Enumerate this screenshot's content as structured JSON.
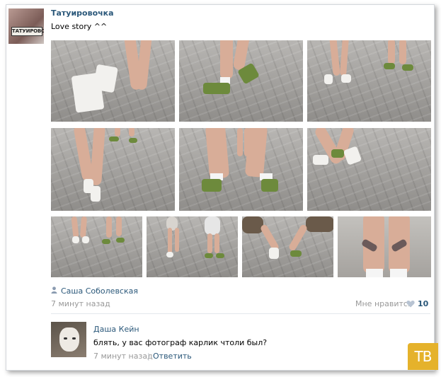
{
  "post": {
    "author": "Татуировочка",
    "avatar_text": "ТАТУИРОВОЧКА",
    "text": "Love story ^^",
    "photos": [
      {
        "scene": "heels-walking"
      },
      {
        "scene": "sneakers-walking"
      },
      {
        "scene": "couple-walking"
      },
      {
        "scene": "couple-standing"
      },
      {
        "scene": "legs-closeup"
      },
      {
        "scene": "heels-sneakers"
      },
      {
        "scene": "couple-far"
      },
      {
        "scene": "couple-holding-hands"
      },
      {
        "scene": "chairs-sitting"
      },
      {
        "scene": "tattoo-calves"
      }
    ],
    "liker_icon": "person-icon",
    "liker": "Саша Соболевская",
    "time": "7 минут назад",
    "like_label": "Мне нравится",
    "like_icon": "heart-icon",
    "like_count": "10"
  },
  "comment": {
    "author": "Даша Кейн",
    "text": "блять, у вас фотограф карлик чтоли был?",
    "time": "7 минут назад",
    "separator": "|",
    "reply_label": "Ответить"
  },
  "watermark": "ТВ",
  "colors": {
    "link": "#2b587a",
    "muted": "#999999",
    "badge": "#e5b22b"
  }
}
